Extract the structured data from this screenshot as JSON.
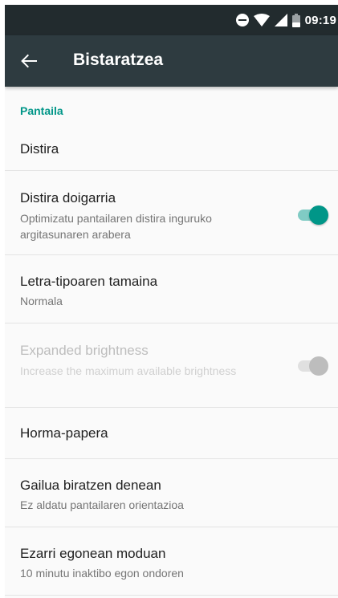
{
  "status_bar": {
    "time": "09:19",
    "icons": [
      "do-not-disturb-icon",
      "wifi-icon",
      "signal-icon",
      "battery-icon"
    ]
  },
  "app_bar": {
    "back_icon": "arrow-back-icon",
    "title": "Bistaratzea"
  },
  "section": {
    "header": "Pantaila"
  },
  "settings": [
    {
      "title": "Distira"
    },
    {
      "title": "Distira doigarria",
      "summary": "Optimizatu pantailaren distira inguruko argitasunaren arabera",
      "toggle": true
    },
    {
      "title": "Letra-tipoaren tamaina",
      "summary": "Normala"
    },
    {
      "title": "Expanded brightness",
      "summary": "Increase the maximum available brightness",
      "toggle": true,
      "disabled": true
    },
    {
      "title": "Horma-papera"
    },
    {
      "title": "Gailua biratzen denean",
      "summary": "Ez aldatu pantailaren orientazioa"
    },
    {
      "title": "Ezarri egonean moduan",
      "summary": "10 minutu inaktibo egon ondoren"
    }
  ],
  "colors": {
    "status_bar": "#222b2e",
    "app_bar": "#2e3b40",
    "accent": "#009688",
    "accent_track": "#80cbc4",
    "disabled_text": "#bdbdbd"
  }
}
